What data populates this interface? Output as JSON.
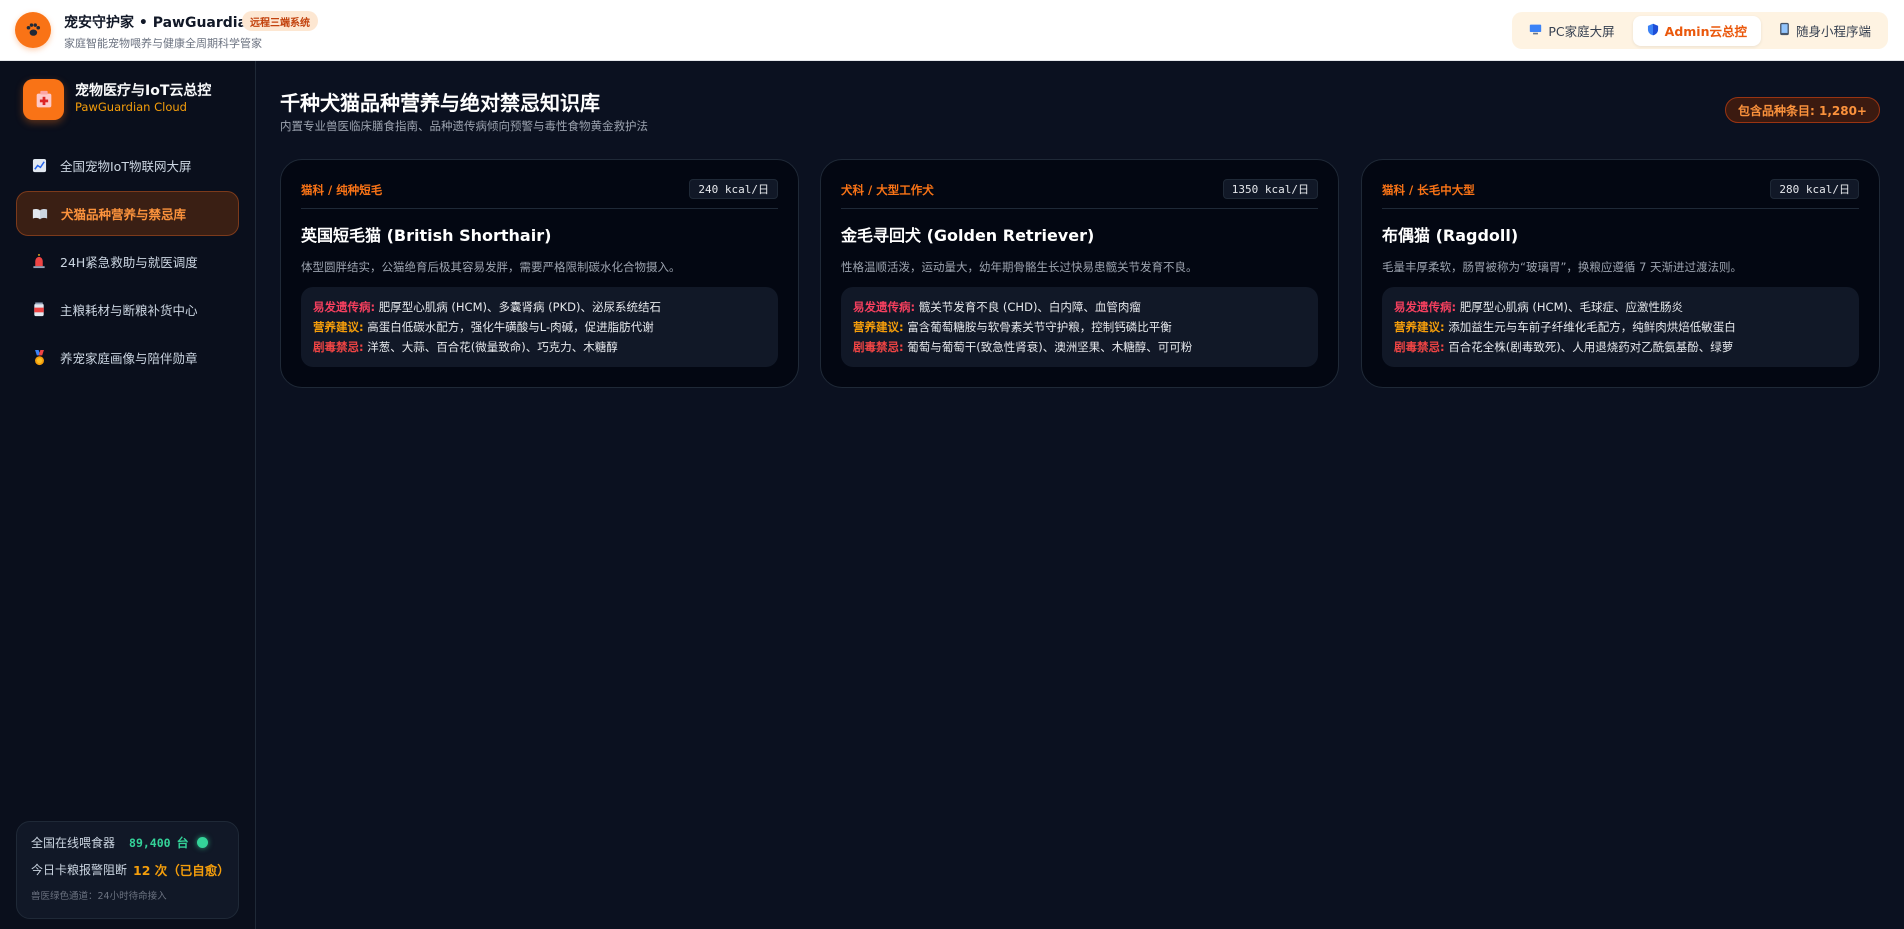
{
  "header": {
    "title": "宠安守护家 • PawGuardian",
    "badge": "远程三端系统",
    "subtitle": "家庭智能宠物喂养与健康全周期科学管家",
    "switcher": [
      {
        "label": "PC家庭大屏",
        "icon": "monitor-icon"
      },
      {
        "label": "Admin云总控",
        "icon": "shield-icon"
      },
      {
        "label": "随身小程序端",
        "icon": "phone-icon"
      }
    ],
    "active_tab": "Admin云总控"
  },
  "sidebar": {
    "title": "宠物医疗与IoT云总控",
    "subtitle": "PawGuardian Cloud",
    "items": [
      {
        "label": "全国宠物IoT物联网大屏",
        "icon": "chart-icon"
      },
      {
        "label": "犬猫品种营养与禁忌库",
        "icon": "book-icon"
      },
      {
        "label": "24H紧急救助与就医调度",
        "icon": "siren-icon"
      },
      {
        "label": "主粮耗材与断粮补货中心",
        "icon": "can-icon"
      },
      {
        "label": "养宠家庭画像与陪伴勋章",
        "icon": "medal-icon"
      }
    ],
    "active_item": "犬猫品种营养与禁忌库",
    "stats": {
      "feeders_label": "全国在线喂食器",
      "feeders_value": "89,400",
      "feeders_unit": "台",
      "alerts_label": "今日卡粮报警阻断",
      "alerts_value": "12 次（已自愈）",
      "footer": "兽医绿色通道：24小时待命接入"
    }
  },
  "main": {
    "title": "千种犬猫品种营养与绝对禁忌知识库",
    "subtitle": "内置专业兽医临床膳食指南、品种遗传病倾向预警与毒性食物黄金救护法",
    "count_badge": "包含品种条目: 1,280+",
    "cards": [
      {
        "tag": "猫科 / 纯种短毛",
        "kcal": "240 kcal/日",
        "name": "英国短毛猫 (British Shorthair)",
        "desc": "体型圆胖结实，公猫绝育后极其容易发胖，需要严格限制碳水化合物摄入。",
        "disease_label": "易发遗传病:",
        "disease": "肥厚型心肌病 (HCM)、多囊肾病 (PKD)、泌尿系统结石",
        "nutrition_label": "营养建议:",
        "nutrition": "高蛋白低碳水配方，强化牛磺酸与L-肉碱，促进脂肪代谢",
        "toxic_label": "剧毒禁忌:",
        "toxic": "洋葱、大蒜、百合花(微量致命)、巧克力、木糖醇"
      },
      {
        "tag": "犬科 / 大型工作犬",
        "kcal": "1350 kcal/日",
        "name": "金毛寻回犬 (Golden Retriever)",
        "desc": "性格温顺活泼，运动量大，幼年期骨骼生长过快易患髋关节发育不良。",
        "disease_label": "易发遗传病:",
        "disease": "髋关节发育不良 (CHD)、白内障、血管肉瘤",
        "nutrition_label": "营养建议:",
        "nutrition": "富含葡萄糖胺与软骨素关节守护粮，控制钙磷比平衡",
        "toxic_label": "剧毒禁忌:",
        "toxic": "葡萄与葡萄干(致急性肾衰)、澳洲坚果、木糖醇、可可粉"
      },
      {
        "tag": "猫科 / 长毛中大型",
        "kcal": "280 kcal/日",
        "name": "布偶猫 (Ragdoll)",
        "desc": "毛量丰厚柔软，肠胃被称为“玻璃胃”，换粮应遵循 7 天渐进过渡法则。",
        "disease_label": "易发遗传病:",
        "disease": "肥厚型心肌病 (HCM)、毛球症、应激性肠炎",
        "nutrition_label": "营养建议:",
        "nutrition": "添加益生元与车前子纤维化毛配方，纯鲜肉烘焙低敏蛋白",
        "toxic_label": "剧毒禁忌:",
        "toxic": "百合花全株(剧毒致死)、人用退烧药对乙酰氨基酚、绿萝"
      }
    ]
  }
}
